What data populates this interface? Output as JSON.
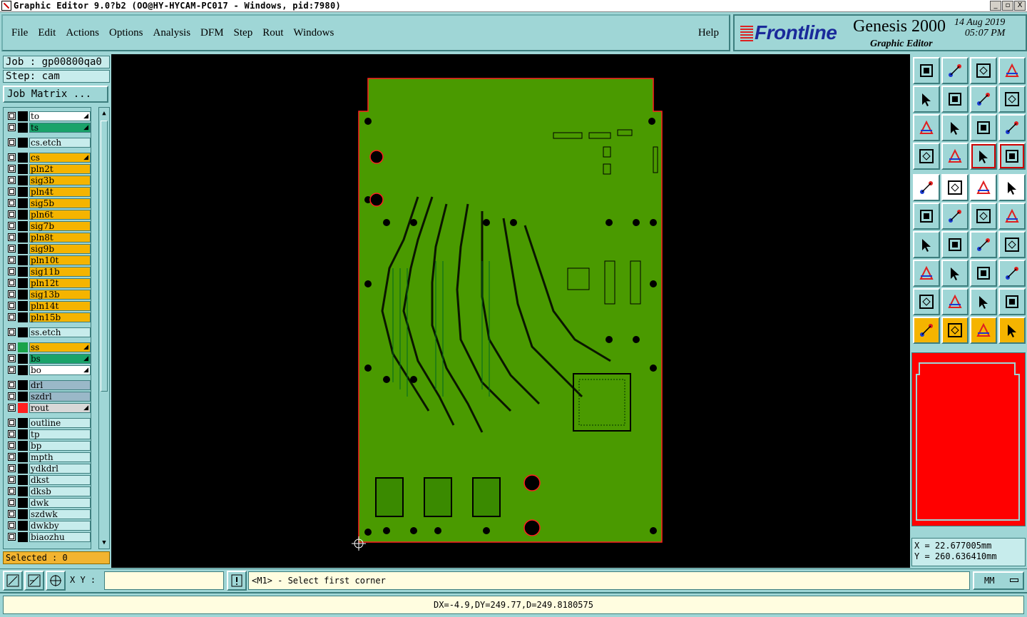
{
  "window": {
    "title": "Graphic Editor 9.0?b2 (OO@HY-HYCAM-PC017 - Windows, pid:7980)",
    "controls": [
      "_",
      "▫",
      "X"
    ]
  },
  "menu": [
    "File",
    "Edit",
    "Actions",
    "Options",
    "Analysis",
    "DFM",
    "Step",
    "Rout",
    "Windows"
  ],
  "help_label": "Help",
  "brand": {
    "logo": "Frontline",
    "product": "Genesis 2000",
    "subtitle": "Graphic Editor",
    "date": "14 Aug 2019",
    "time": "05:07 PM"
  },
  "job": {
    "job_line": "Job : gp00800qa0",
    "step_line": "Step: cam",
    "matrix_button": "Job Matrix ..."
  },
  "layers": [
    {
      "name": "to",
      "color": "#ffffff",
      "swatch": "#000000",
      "arrow": true
    },
    {
      "name": "ts",
      "color": "#1aa36a",
      "swatch": "#000000",
      "arrow": true
    },
    {
      "name": "cs.etch",
      "color": "#c7ecec",
      "swatch": "#000000",
      "arrow": false
    },
    {
      "name": "cs",
      "color": "#f5b400",
      "swatch": "#000000",
      "arrow": true
    },
    {
      "name": "pln2t",
      "color": "#f5b400",
      "swatch": "#000000",
      "arrow": false
    },
    {
      "name": "sig3b",
      "color": "#f5b400",
      "swatch": "#000000",
      "arrow": false
    },
    {
      "name": "pln4t",
      "color": "#f5b400",
      "swatch": "#000000",
      "arrow": false
    },
    {
      "name": "sig5b",
      "color": "#f5b400",
      "swatch": "#000000",
      "arrow": false
    },
    {
      "name": "pln6t",
      "color": "#f5b400",
      "swatch": "#000000",
      "arrow": false
    },
    {
      "name": "sig7b",
      "color": "#f5b400",
      "swatch": "#000000",
      "arrow": false
    },
    {
      "name": "pln8t",
      "color": "#f5b400",
      "swatch": "#000000",
      "arrow": false
    },
    {
      "name": "sig9b",
      "color": "#f5b400",
      "swatch": "#000000",
      "arrow": false
    },
    {
      "name": "pln10t",
      "color": "#f5b400",
      "swatch": "#000000",
      "arrow": false
    },
    {
      "name": "sig11b",
      "color": "#f5b400",
      "swatch": "#000000",
      "arrow": false
    },
    {
      "name": "pln12t",
      "color": "#f5b400",
      "swatch": "#000000",
      "arrow": false
    },
    {
      "name": "sig13b",
      "color": "#f5b400",
      "swatch": "#000000",
      "arrow": false
    },
    {
      "name": "pln14t",
      "color": "#f5b400",
      "swatch": "#000000",
      "arrow": false
    },
    {
      "name": "pln15b",
      "color": "#f5b400",
      "swatch": "#000000",
      "arrow": false
    },
    {
      "name": "ss.etch",
      "color": "#c7ecec",
      "swatch": "#000000",
      "arrow": false
    },
    {
      "name": "ss",
      "color": "#f5b400",
      "swatch": "#1aa34a",
      "arrow": true
    },
    {
      "name": "bs",
      "color": "#1aa36a",
      "swatch": "#000000",
      "arrow": true
    },
    {
      "name": "bo",
      "color": "#ffffff",
      "swatch": "#000000",
      "arrow": true
    },
    {
      "name": "drl",
      "color": "#9ab8c8",
      "swatch": "#000000",
      "arrow": false
    },
    {
      "name": "szdrl",
      "color": "#9ab8c8",
      "swatch": "#000000",
      "arrow": false
    },
    {
      "name": "rout",
      "color": "#d8d8d8",
      "swatch": "#ff2020",
      "arrow": true
    },
    {
      "name": "outline",
      "color": "#c7ecec",
      "swatch": "#000000",
      "arrow": false
    },
    {
      "name": "tp",
      "color": "#c7ecec",
      "swatch": "#000000",
      "arrow": false
    },
    {
      "name": "bp",
      "color": "#c7ecec",
      "swatch": "#000000",
      "arrow": false
    },
    {
      "name": "mpth",
      "color": "#c7ecec",
      "swatch": "#000000",
      "arrow": false
    },
    {
      "name": "ydkdrl",
      "color": "#c7ecec",
      "swatch": "#000000",
      "arrow": false
    },
    {
      "name": "dkst",
      "color": "#c7ecec",
      "swatch": "#000000",
      "arrow": false
    },
    {
      "name": "dksb",
      "color": "#c7ecec",
      "swatch": "#000000",
      "arrow": false
    },
    {
      "name": "dwk",
      "color": "#c7ecec",
      "swatch": "#000000",
      "arrow": false
    },
    {
      "name": "szdwk",
      "color": "#c7ecec",
      "swatch": "#000000",
      "arrow": false
    },
    {
      "name": "dwkby",
      "color": "#c7ecec",
      "swatch": "#000000",
      "arrow": false
    },
    {
      "name": "biaozhu",
      "color": "#c7ecec",
      "swatch": "#000000",
      "arrow": false
    }
  ],
  "selected": "Selected : 0",
  "tools": [
    "load-icon",
    "save-icon",
    "home-icon",
    "panel-icon",
    "zoom-out-icon",
    "zoom-in-icon",
    "redraw-icon",
    "snap-icon",
    "fit-icon",
    "center-icon",
    "scale-icon",
    "help-icon",
    "ruler-icon",
    "probe-icon",
    "layers-a-icon",
    "layers-b-icon",
    "fill-icon",
    "box-icon",
    "grid-icon",
    "circle-icon",
    "connect-icon",
    "cross-icon",
    "point-icon",
    "diagonal-icon",
    "angle-icon",
    "line-icon",
    "arc-icon",
    "text-icon",
    "shape-icon",
    "measure-icon",
    "span-icon",
    "cluster-icon",
    "tri-a-icon",
    "tri-b-icon",
    "tri-c-icon",
    "tri-d-icon",
    "cursor-icon",
    "cursor-box-icon",
    "cursor-pick-icon",
    "cursor-net-icon"
  ],
  "coords": {
    "x": "X  = 22.677005mm",
    "y": "Y  = 260.636410mm"
  },
  "bottom": {
    "xy_label": "X Y :",
    "xy_value": "",
    "prompt": "<M1> - Select first corner",
    "units": "MM"
  },
  "status": "DX=-4.9,DY=249.77,D=249.8180575",
  "colors": {
    "board": "#4a9a00",
    "board_outline": "#ff2020",
    "panel": "#9fd6d6"
  }
}
